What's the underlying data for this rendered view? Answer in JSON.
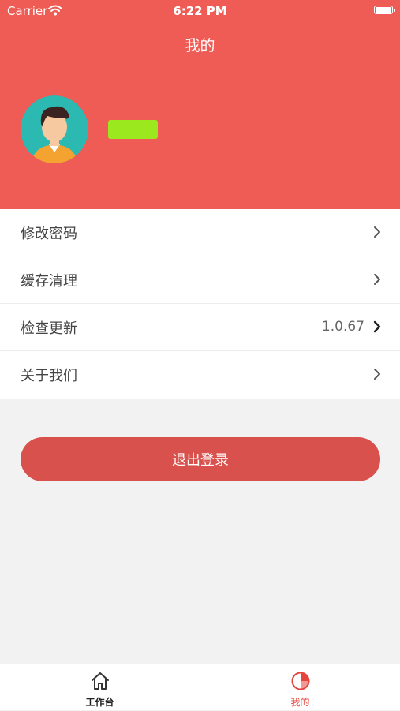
{
  "status_bar": {
    "carrier": "Carrier",
    "time": "6:22 PM"
  },
  "header": {
    "title": "我的",
    "background_color": "#ee5c55"
  },
  "menu": {
    "items": [
      {
        "label": "修改密码",
        "value": ""
      },
      {
        "label": "缓存清理",
        "value": ""
      },
      {
        "label": "检查更新",
        "value": "1.0.67"
      },
      {
        "label": "关于我们",
        "value": ""
      }
    ]
  },
  "logout": {
    "label": "退出登录",
    "color": "#d9514c"
  },
  "tab_bar": {
    "tabs": [
      {
        "label": "工作台",
        "icon": "home-icon",
        "active": false
      },
      {
        "label": "我的",
        "icon": "pie-chart-icon",
        "active": true
      }
    ],
    "active_color": "#e5453d"
  }
}
